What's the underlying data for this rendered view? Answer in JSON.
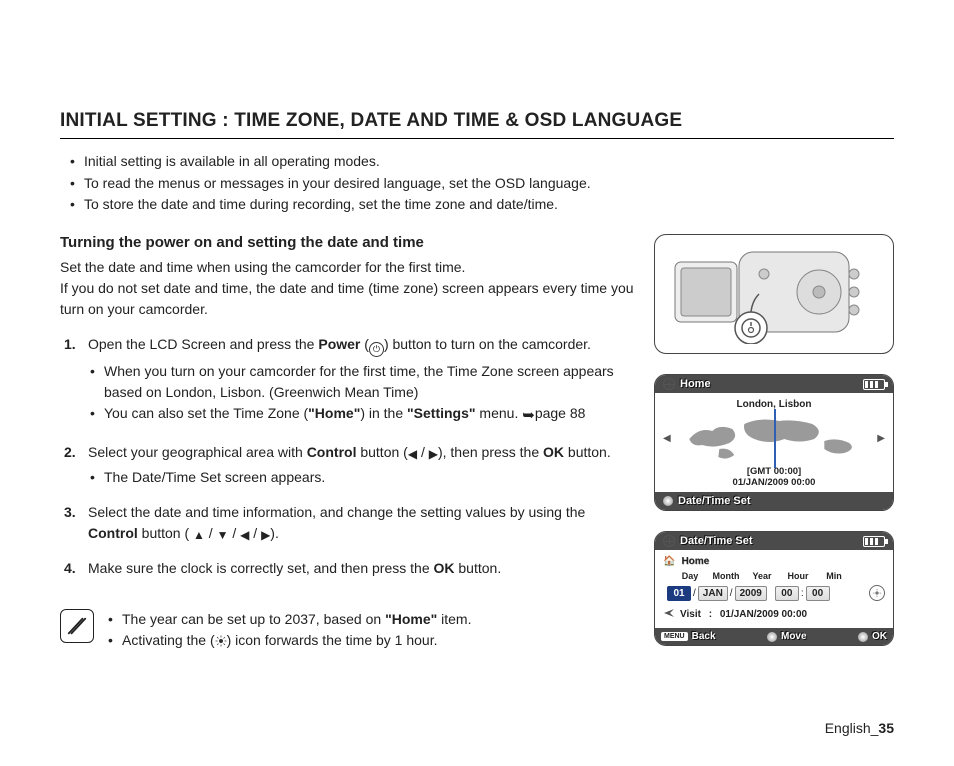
{
  "title": "INITIAL SETTING : TIME ZONE, DATE AND TIME & OSD LANGUAGE",
  "intro": [
    "Initial setting is available in all operating modes.",
    "To read the menus or messages in your desired language, set the OSD language.",
    "To store the date and time during recording, set the time zone and date/time."
  ],
  "subheading": "Turning the power on and setting the date and time",
  "para1": "Set the date and time when using the camcorder for the first time.",
  "para2": "If you do not set date and time, the date and time (time zone) screen appears every time you turn on your camcorder.",
  "steps": {
    "s1a": "Open the LCD Screen and press the ",
    "s1b": "Power",
    "s1c": " (",
    "s1d": ") button to turn on the camcorder.",
    "s1_sub1": "When you turn on your camcorder for the first time, the Time Zone screen appears based on London, Lisbon. (Greenwich Mean Time)",
    "s1_sub2a": "You can also set the Time Zone (",
    "s1_sub2b": "\"Home\"",
    "s1_sub2c": ") in the ",
    "s1_sub2d": "\"Settings\"",
    "s1_sub2e": " menu. ",
    "s1_sub2f": "page 88",
    "s2a": "Select your geographical area with ",
    "s2b": "Control",
    "s2c": " button (",
    "s2d": " / ",
    "s2e": "), then press the ",
    "s2f": "OK",
    "s2g": " button.",
    "s2_sub1": "The Date/Time Set screen appears.",
    "s3a": "Select the date and time information, and change the setting values by using the ",
    "s3b": "Control",
    "s3c": " button ( ",
    "s3d": " / ",
    "s3e": " / ",
    "s3f": " / ",
    "s3g": ").",
    "s4a": "Make sure the clock is correctly set, and then press the ",
    "s4b": "OK",
    "s4c": " button."
  },
  "note": {
    "n1a": "The year can be set up to 2037, based on ",
    "n1b": "\"Home\"",
    "n1c": " item.",
    "n2a": "Activating the (",
    "n2b": ") icon forwards the time by 1 hour."
  },
  "screen1": {
    "title": "Home",
    "city": "London, Lisbon",
    "gmt": "[GMT 00:00]",
    "date": "01/JAN/2009 00:00",
    "footer": "Date/Time Set"
  },
  "screen2": {
    "title": "Date/Time Set",
    "home": "Home",
    "hdr": {
      "day": "Day",
      "month": "Month",
      "year": "Year",
      "hour": "Hour",
      "min": "Min"
    },
    "val": {
      "day": "01",
      "month": "JAN",
      "year": "2009",
      "hour": "00",
      "min": "00"
    },
    "visit_label": "Visit",
    "visit_value": "01/JAN/2009 00:00",
    "foot": {
      "menu": "MENU",
      "back": "Back",
      "move": "Move",
      "ok": "OK"
    }
  },
  "footer": {
    "lang": "English",
    "page": "35",
    "sep": "_"
  }
}
